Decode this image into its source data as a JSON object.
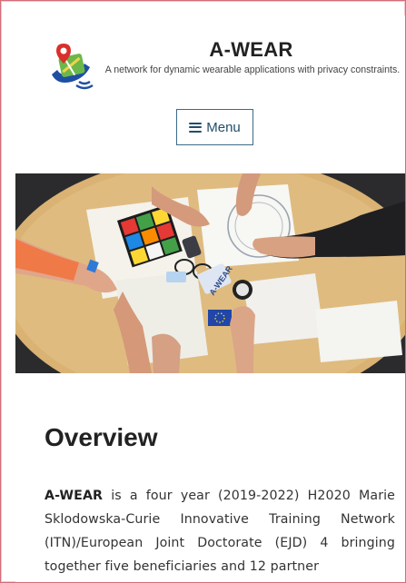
{
  "site": {
    "title": "A-WEAR",
    "description": "A network for dynamic wearable applications with privacy constraints."
  },
  "menu": {
    "label": "Menu"
  },
  "hero": {
    "puzzle_letters": "A-WEAR"
  },
  "overview": {
    "heading": "Overview",
    "intro_bold": "A-WEAR",
    "intro_text": " is a four year (2019-2022) H2020 Marie Sklodowska-Curie Innovative Training Network (ITN)/European Joint Doctorate (EJD) 4 bringing together five beneficiaries and 12 partner"
  },
  "colors": {
    "menu_border": "#3b6a86",
    "menu_text": "#1f4e6b",
    "outer_frame": "#e79aa3"
  }
}
